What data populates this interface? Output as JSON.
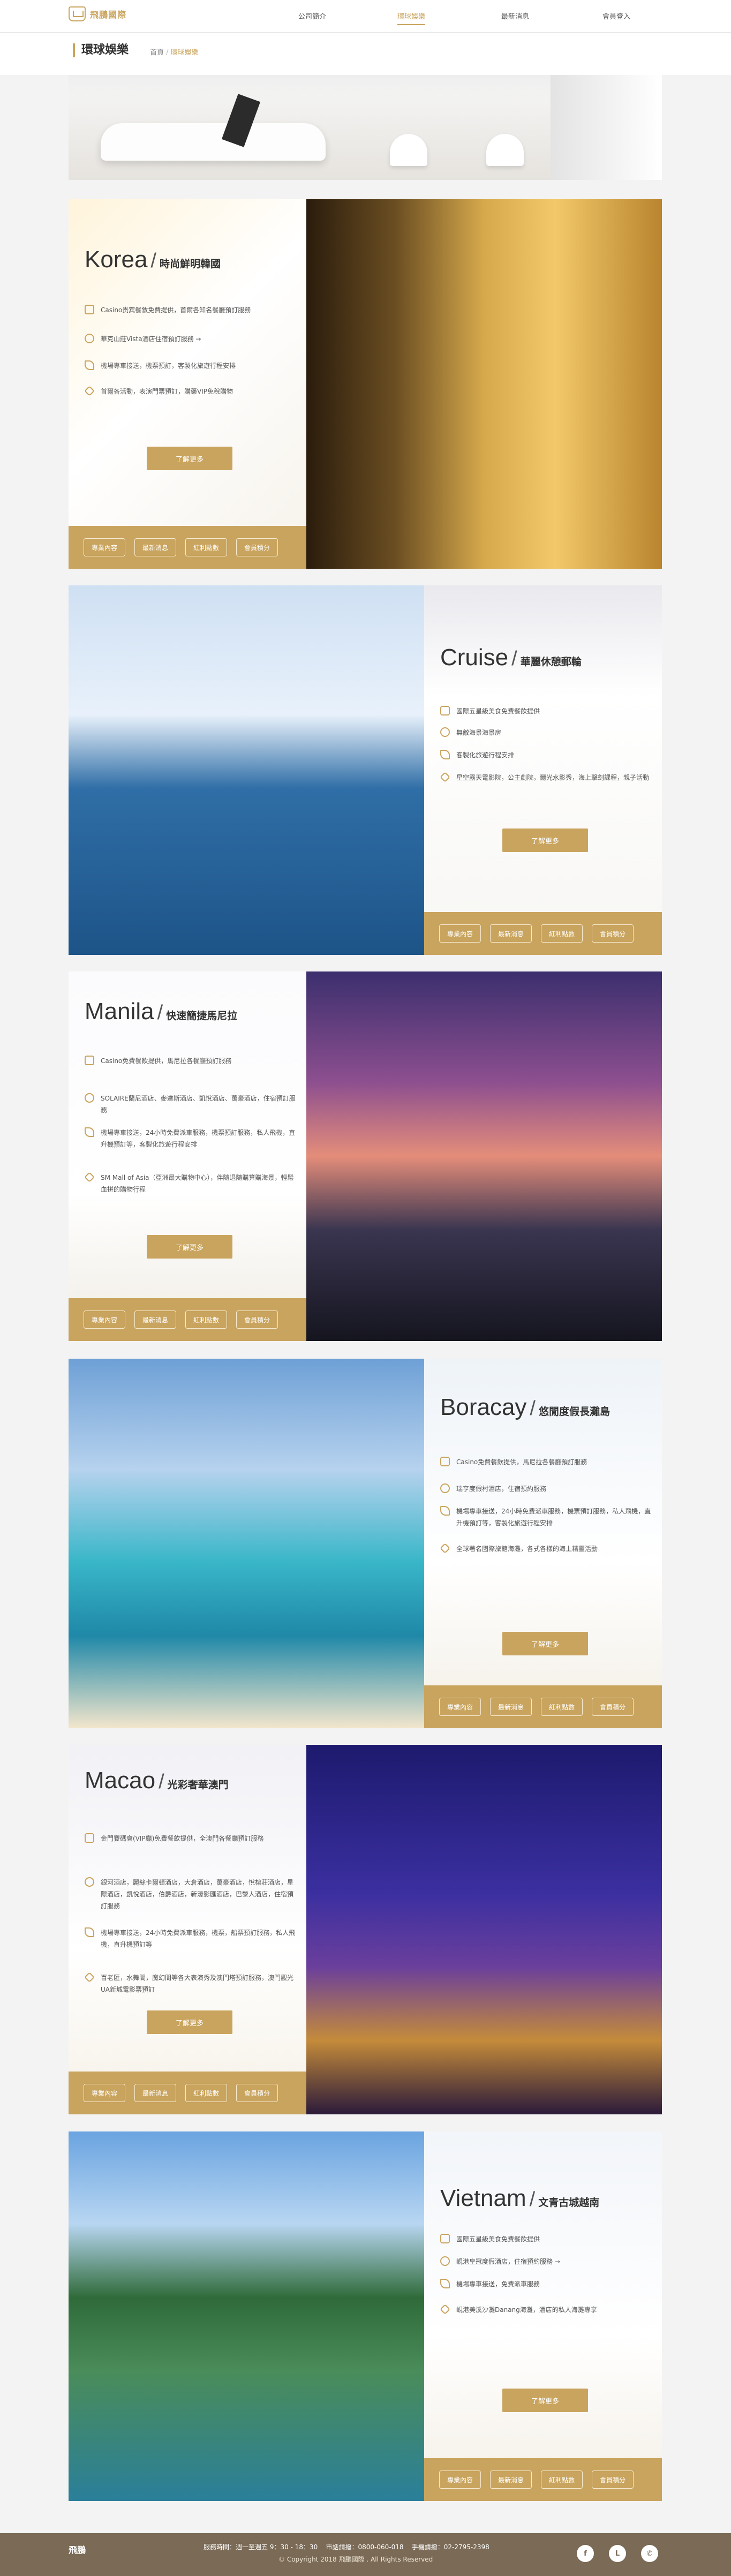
{
  "brand": {
    "name": "飛鵬國際"
  },
  "nav": {
    "items": [
      "公司簡介",
      "環球娛樂",
      "最新消息",
      "會員登入"
    ],
    "active": "環球娛樂"
  },
  "page": {
    "title": "環球娛樂"
  },
  "breadcrumb": {
    "home": "首頁",
    "separator": "/",
    "current": "環球娛樂"
  },
  "footer_buttons": [
    "專業內容",
    "最新消息",
    "紅利點數",
    "會員積分"
  ],
  "more_label": "了解更多",
  "destinations": [
    {
      "id": "korea",
      "name": "Korea",
      "zh": "時尚鮮明韓國",
      "features": [
        "Casino贵宾餐敘免費提供，首爾各知名餐廳預訂服務",
        "華克山莊Vista酒店住宿預訂服務 →",
        "機場專車接送，機票預訂，客製化旅遊行程安排",
        "首爾各活動，表演門票預訂，購藥VIP免稅購物"
      ]
    },
    {
      "id": "cruise",
      "name": "Cruise",
      "zh": "華麗休憩郵輪",
      "features": [
        "國際五星級美食免費餐飲提供",
        "無敵海景海景房",
        "客製化旅遊行程安排",
        "星空露天電影院，公主劇院，爾光水影秀，海上擊劍課程，親子活動"
      ]
    },
    {
      "id": "manila",
      "name": "Manila",
      "zh": "快速簡捷馬尼拉",
      "features": [
        "Casino免費餐飲提供，馬尼拉各餐廳預訂服務",
        "SOLAIRE蘭尼酒店、麥達斯酒店、凱悅酒店、萬豪酒店，住宿預訂服務",
        "機場專車接送，24小時免費派車服務，機票預訂服務，私人飛機，直升機預訂等，客製化旅遊行程安排",
        "SM Mall of Asia（亞洲最大購物中心），伴隨退隨購算購海景，輕鬆血拼的購物行程"
      ]
    },
    {
      "id": "boracay",
      "name": "Boracay",
      "zh": "悠閒度假長灘島",
      "features": [
        "Casino免費餐飲提供，馬尼拉各餐廳預訂服務",
        "瑞亨度假村酒店，住宿預約服務",
        "機場專車接送，24小時免費派車服務，機票預訂服務，私人飛機，直升機預訂等，客製化旅遊行程安排",
        "全球著名國際旅館海灘，各式各樣的海上精靈活動"
      ]
    },
    {
      "id": "macao",
      "name": "Macao",
      "zh": "光彩奢華澳門",
      "features": [
        "金門賽碼會(VIP廳)免費餐飲提供，全澳門各餐廳預訂服務",
        "銀河酒店，麗絲卡爾頓酒店，大倉酒店，萬豪酒店，悅榕莊酒店，星際酒店，凱悅酒店，伯爵酒店，新濠影匯酒店，巴黎人酒店，住宿預訂服務",
        "機場專車接送，24小時免費派車服務，機票，船票預訂服務，私人飛機，直升機預訂等",
        "百老匯，水舞間，魔幻間等各大表演秀及澳門塔預訂服務，澳門觀光UA新城電影票預訂"
      ]
    },
    {
      "id": "vietnam",
      "name": "Vietnam",
      "zh": "文青古城越南",
      "features": [
        "國際五星級美食免費餐飲提供",
        "峴港皇冠度假酒店，住宿預約服務 →",
        "機場專車接送，免費派車服務",
        "峴港美溪沙灘Danang海灘，酒店的私人海灘專享"
      ]
    }
  ],
  "footer": {
    "logo": "飛鵬",
    "hours": "服務時間：週一至週五 9：30 - 18：30",
    "phone": "市話請撥：0800-060-018",
    "mobile": "手機請撥：02-2795-2398",
    "copyright": "© Copyright 2018 飛鵬國際 . All Rights Reserved",
    "social": [
      {
        "icon": "facebook-icon",
        "glyph": "f"
      },
      {
        "icon": "line-icon",
        "glyph": "L"
      },
      {
        "icon": "phone-icon",
        "glyph": "✆"
      }
    ]
  },
  "colors": {
    "accent": "#c9a45e",
    "footer_bg": "#7a6a56"
  }
}
